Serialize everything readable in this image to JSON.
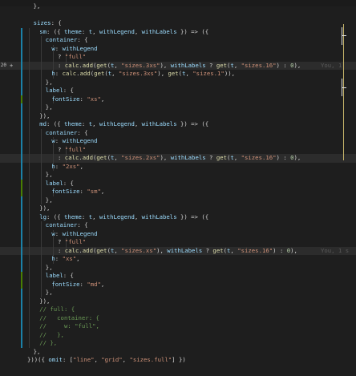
{
  "editor": {
    "line_numbers": [
      "",
      "",
      "",
      "",
      "",
      "",
      "",
      "",
      "",
      "",
      "",
      "",
      "",
      "",
      "",
      "",
      "",
      "",
      "",
      "",
      "",
      "",
      "",
      "",
      "",
      "",
      "",
      "",
      "",
      "",
      "",
      "",
      "",
      "",
      "",
      "",
      "",
      "",
      "",
      "",
      ""
    ],
    "lines": [
      {
        "num": "",
        "indent": 1,
        "parts": [
          [
            "o",
            "},"
          ]
        ]
      },
      {
        "num": "",
        "indent": 0,
        "parts": []
      },
      {
        "num": "",
        "indent": 1,
        "parts": [
          [
            "p",
            "sizes"
          ],
          [
            "o",
            ": {"
          ]
        ]
      },
      {
        "num": "",
        "indent": 2,
        "mark": "mod",
        "parts": [
          [
            "p",
            "sm"
          ],
          [
            "o",
            ": ({ "
          ],
          [
            "p",
            "theme"
          ],
          [
            "o",
            ": "
          ],
          [
            "p",
            "t"
          ],
          [
            "o",
            ", "
          ],
          [
            "p",
            "withLegend"
          ],
          [
            "o",
            ", "
          ],
          [
            "p",
            "withLabels"
          ],
          [
            "o",
            " }) => ({"
          ]
        ]
      },
      {
        "num": "",
        "indent": 3,
        "mark": "mod",
        "parts": [
          [
            "p",
            "container"
          ],
          [
            "o",
            ": {"
          ]
        ]
      },
      {
        "num": "",
        "indent": 4,
        "mark": "mod",
        "parts": [
          [
            "p",
            "w"
          ],
          [
            "o",
            ": "
          ],
          [
            "p",
            "withLegend"
          ]
        ]
      },
      {
        "num": "",
        "indent": 5,
        "mark": "mod",
        "parts": [
          [
            "o",
            "? "
          ],
          [
            "s",
            "\"full\""
          ]
        ]
      },
      {
        "num": "20",
        "indent": 5,
        "mark": "mod",
        "hl": true,
        "plus": true,
        "active": true,
        "ghost": "You, 1",
        "parts": [
          [
            "o",
            ": "
          ],
          [
            "f",
            "calc"
          ],
          [
            "o",
            "."
          ],
          [
            "f",
            "add"
          ],
          [
            "o",
            "("
          ],
          [
            "f",
            "get"
          ],
          [
            "o",
            "("
          ],
          [
            "p",
            "t"
          ],
          [
            "o",
            ", "
          ],
          [
            "s",
            "\"sizes.3xs\""
          ],
          [
            "o",
            "), "
          ],
          [
            "p",
            "withLabels"
          ],
          [
            "o",
            " ? "
          ],
          [
            "f",
            "get"
          ],
          [
            "o",
            "("
          ],
          [
            "p",
            "t"
          ],
          [
            "o",
            ", "
          ],
          [
            "s",
            "\"sizes.16\""
          ],
          [
            "o",
            ") : "
          ],
          [
            "n",
            "0"
          ],
          [
            "o",
            "),"
          ]
        ]
      },
      {
        "num": "",
        "indent": 4,
        "mark": "mod",
        "parts": [
          [
            "p",
            "h"
          ],
          [
            "o",
            ": "
          ],
          [
            "f",
            "calc"
          ],
          [
            "o",
            "."
          ],
          [
            "f",
            "add"
          ],
          [
            "o",
            "("
          ],
          [
            "f",
            "get"
          ],
          [
            "o",
            "("
          ],
          [
            "p",
            "t"
          ],
          [
            "o",
            ", "
          ],
          [
            "s",
            "\"sizes.3xs\""
          ],
          [
            "o",
            "), "
          ],
          [
            "f",
            "get"
          ],
          [
            "o",
            "("
          ],
          [
            "p",
            "t"
          ],
          [
            "o",
            ", "
          ],
          [
            "s",
            "\"sizes.1\""
          ],
          [
            "o",
            ")),"
          ]
        ]
      },
      {
        "num": "",
        "indent": 3,
        "mark": "mod",
        "parts": [
          [
            "o",
            "},"
          ]
        ]
      },
      {
        "num": "",
        "indent": 3,
        "mark": "mod",
        "parts": [
          [
            "p",
            "label"
          ],
          [
            "o",
            ": {"
          ]
        ]
      },
      {
        "num": "",
        "indent": 4,
        "mark": "add",
        "parts": [
          [
            "p",
            "fontSize"
          ],
          [
            "o",
            ": "
          ],
          [
            "s",
            "\"xs\""
          ],
          [
            "o",
            ","
          ]
        ]
      },
      {
        "num": "",
        "indent": 3,
        "mark": "mod",
        "parts": [
          [
            "o",
            "},"
          ]
        ]
      },
      {
        "num": "",
        "indent": 2,
        "mark": "mod",
        "parts": [
          [
            "o",
            "}),"
          ]
        ]
      },
      {
        "num": "",
        "indent": 2,
        "mark": "mod",
        "parts": [
          [
            "p",
            "md"
          ],
          [
            "o",
            ": ({ "
          ],
          [
            "p",
            "theme"
          ],
          [
            "o",
            ": "
          ],
          [
            "p",
            "t"
          ],
          [
            "o",
            ", "
          ],
          [
            "p",
            "withLegend"
          ],
          [
            "o",
            ", "
          ],
          [
            "p",
            "withLabels"
          ],
          [
            "o",
            " }) => ({"
          ]
        ]
      },
      {
        "num": "",
        "indent": 3,
        "mark": "mod",
        "parts": [
          [
            "p",
            "container"
          ],
          [
            "o",
            ": {"
          ]
        ]
      },
      {
        "num": "",
        "indent": 4,
        "mark": "mod",
        "parts": [
          [
            "p",
            "w"
          ],
          [
            "o",
            ": "
          ],
          [
            "p",
            "withLegend"
          ]
        ]
      },
      {
        "num": "",
        "indent": 5,
        "mark": "mod",
        "parts": [
          [
            "o",
            "? "
          ],
          [
            "s",
            "\"full\""
          ]
        ]
      },
      {
        "num": "",
        "indent": 5,
        "mark": "mod",
        "hl": true,
        "parts": [
          [
            "o",
            ": "
          ],
          [
            "f",
            "calc"
          ],
          [
            "o",
            "."
          ],
          [
            "f",
            "add"
          ],
          [
            "o",
            "("
          ],
          [
            "f",
            "get"
          ],
          [
            "o",
            "("
          ],
          [
            "p",
            "t"
          ],
          [
            "o",
            ", "
          ],
          [
            "s",
            "\"sizes.2xs\""
          ],
          [
            "o",
            "), "
          ],
          [
            "p",
            "withLabels"
          ],
          [
            "o",
            " ? "
          ],
          [
            "f",
            "get"
          ],
          [
            "o",
            "("
          ],
          [
            "p",
            "t"
          ],
          [
            "o",
            ", "
          ],
          [
            "s",
            "\"sizes.16\""
          ],
          [
            "o",
            ") : "
          ],
          [
            "n",
            "0"
          ],
          [
            "o",
            "),"
          ]
        ]
      },
      {
        "num": "",
        "indent": 4,
        "mark": "mod",
        "parts": [
          [
            "p",
            "h"
          ],
          [
            "o",
            ": "
          ],
          [
            "s",
            "\"2xs\""
          ],
          [
            "o",
            ","
          ]
        ]
      },
      {
        "num": "",
        "indent": 3,
        "mark": "mod",
        "parts": [
          [
            "o",
            "},"
          ]
        ]
      },
      {
        "num": "",
        "indent": 3,
        "mark": "add",
        "parts": [
          [
            "p",
            "label"
          ],
          [
            "o",
            ": {"
          ]
        ]
      },
      {
        "num": "",
        "indent": 4,
        "mark": "add",
        "parts": [
          [
            "p",
            "fontSize"
          ],
          [
            "o",
            ": "
          ],
          [
            "s",
            "\"sm\""
          ],
          [
            "o",
            ","
          ]
        ]
      },
      {
        "num": "",
        "indent": 3,
        "mark": "mod",
        "parts": [
          [
            "o",
            "},"
          ]
        ]
      },
      {
        "num": "",
        "indent": 2,
        "mark": "mod",
        "parts": [
          [
            "o",
            "}),"
          ]
        ]
      },
      {
        "num": "",
        "indent": 2,
        "mark": "mod",
        "parts": [
          [
            "p",
            "lg"
          ],
          [
            "o",
            ": ({ "
          ],
          [
            "p",
            "theme"
          ],
          [
            "o",
            ": "
          ],
          [
            "p",
            "t"
          ],
          [
            "o",
            ", "
          ],
          [
            "p",
            "withLegend"
          ],
          [
            "o",
            ", "
          ],
          [
            "p",
            "withLabels"
          ],
          [
            "o",
            " }) => ({"
          ]
        ]
      },
      {
        "num": "",
        "indent": 3,
        "mark": "mod",
        "parts": [
          [
            "p",
            "container"
          ],
          [
            "o",
            ": {"
          ]
        ]
      },
      {
        "num": "",
        "indent": 4,
        "mark": "mod",
        "parts": [
          [
            "p",
            "w"
          ],
          [
            "o",
            ": "
          ],
          [
            "p",
            "withLegend"
          ]
        ]
      },
      {
        "num": "",
        "indent": 5,
        "mark": "mod",
        "parts": [
          [
            "o",
            "? "
          ],
          [
            "s",
            "\"full\""
          ]
        ]
      },
      {
        "num": "",
        "indent": 5,
        "mark": "mod",
        "hl": true,
        "ghost": "You, 1 s",
        "parts": [
          [
            "o",
            ": "
          ],
          [
            "f",
            "calc"
          ],
          [
            "o",
            "."
          ],
          [
            "f",
            "add"
          ],
          [
            "o",
            "("
          ],
          [
            "f",
            "get"
          ],
          [
            "o",
            "("
          ],
          [
            "p",
            "t"
          ],
          [
            "o",
            ", "
          ],
          [
            "s",
            "\"sizes.xs\""
          ],
          [
            "o",
            "), "
          ],
          [
            "p",
            "withLabels"
          ],
          [
            "o",
            " ? "
          ],
          [
            "f",
            "get"
          ],
          [
            "o",
            "("
          ],
          [
            "p",
            "t"
          ],
          [
            "o",
            ", "
          ],
          [
            "s",
            "\"sizes.16\""
          ],
          [
            "o",
            ") : "
          ],
          [
            "n",
            "0"
          ],
          [
            "o",
            "),"
          ]
        ]
      },
      {
        "num": "",
        "indent": 4,
        "mark": "mod",
        "parts": [
          [
            "p",
            "h"
          ],
          [
            "o",
            ": "
          ],
          [
            "s",
            "\"xs\""
          ],
          [
            "o",
            ","
          ]
        ]
      },
      {
        "num": "",
        "indent": 3,
        "mark": "mod",
        "parts": [
          [
            "o",
            "},"
          ]
        ]
      },
      {
        "num": "",
        "indent": 3,
        "mark": "add",
        "parts": [
          [
            "p",
            "label"
          ],
          [
            "o",
            ": {"
          ]
        ]
      },
      {
        "num": "",
        "indent": 4,
        "mark": "add",
        "parts": [
          [
            "p",
            "fontSize"
          ],
          [
            "o",
            ": "
          ],
          [
            "s",
            "\"md\""
          ],
          [
            "o",
            ","
          ]
        ]
      },
      {
        "num": "",
        "indent": 3,
        "mark": "mod",
        "parts": [
          [
            "o",
            "},"
          ]
        ]
      },
      {
        "num": "",
        "indent": 2,
        "mark": "mod",
        "parts": [
          [
            "o",
            "}),"
          ]
        ]
      },
      {
        "num": "",
        "indent": 2,
        "mark": "mod",
        "parts": [
          [
            "c",
            "// full: {"
          ]
        ]
      },
      {
        "num": "",
        "indent": 2,
        "mark": "mod",
        "parts": [
          [
            "c",
            "//   container: {"
          ]
        ]
      },
      {
        "num": "",
        "indent": 2,
        "mark": "mod",
        "parts": [
          [
            "c",
            "//     w: \"full\","
          ]
        ]
      },
      {
        "num": "",
        "indent": 2,
        "mark": "mod",
        "parts": [
          [
            "c",
            "//   },"
          ]
        ]
      },
      {
        "num": "",
        "indent": 2,
        "mark": "mod",
        "parts": [
          [
            "c",
            "// },"
          ]
        ]
      },
      {
        "num": "",
        "indent": 1,
        "parts": [
          [
            "o",
            "},"
          ]
        ]
      },
      {
        "num": "",
        "indent": 0,
        "parts": [
          [
            "o",
            "}))({ "
          ],
          [
            "p",
            "omit"
          ],
          [
            "o",
            ": ["
          ],
          [
            "s",
            "\"line\""
          ],
          [
            "o",
            ", "
          ],
          [
            "s",
            "\"grid\""
          ],
          [
            "o",
            ", "
          ],
          [
            "s",
            "\"sizes.full\""
          ],
          [
            "o",
            "] })"
          ]
        ]
      }
    ]
  },
  "colors": {
    "background": "#1e1e1e",
    "line_highlight": "#2c2c2c",
    "modified_mark": "#1b81a8",
    "added_mark": "#487e02"
  }
}
